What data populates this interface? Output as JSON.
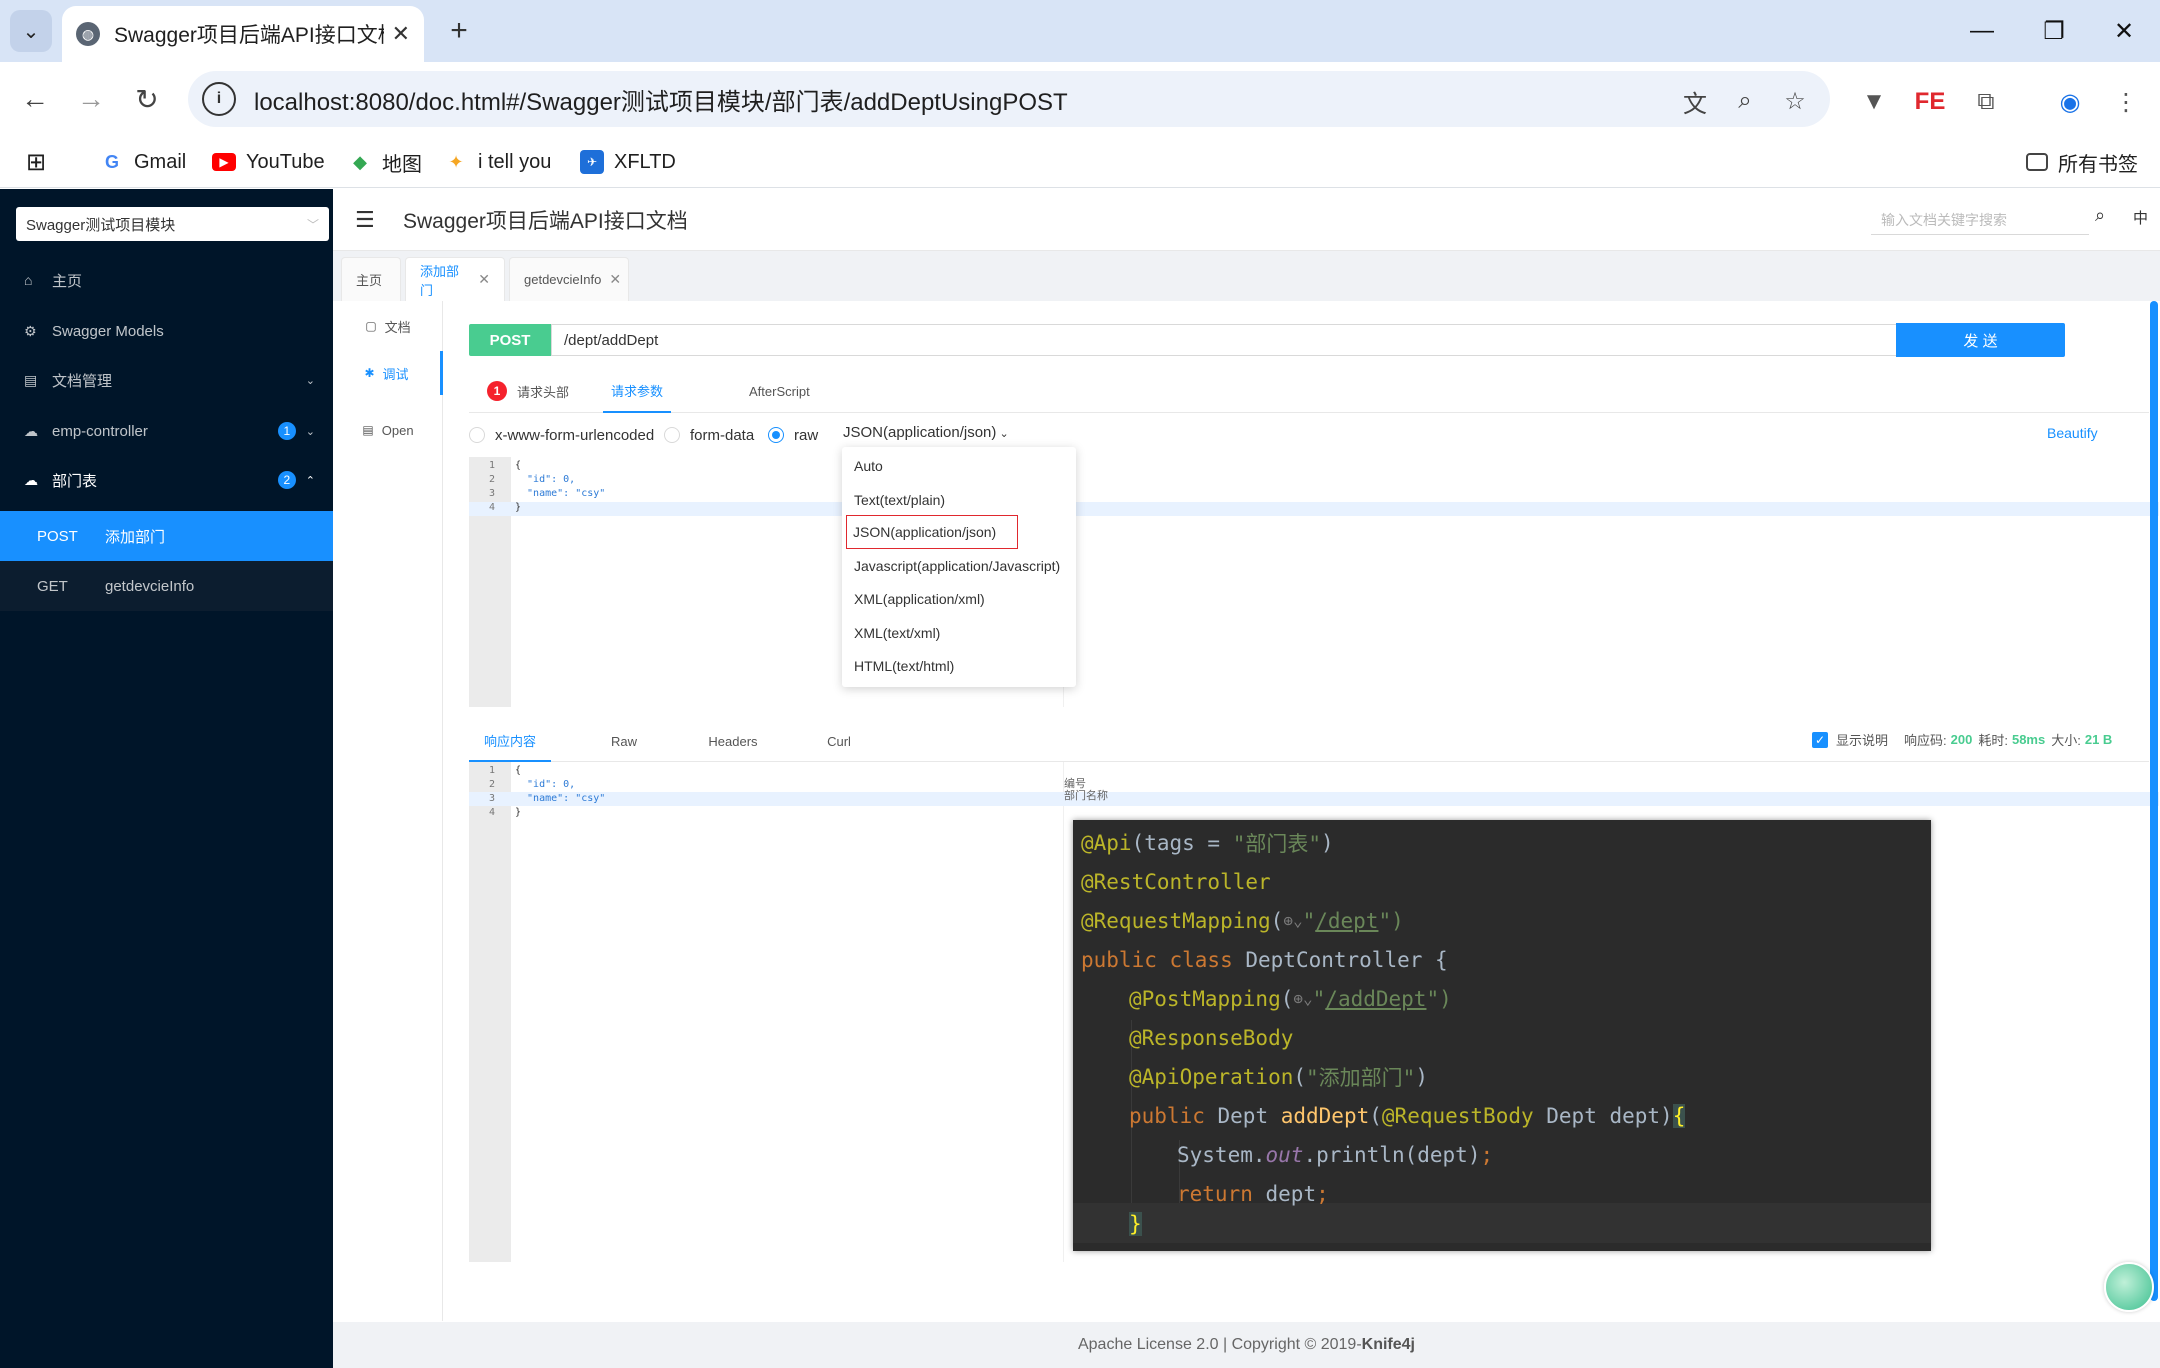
{
  "browser": {
    "tab_title": "Swagger项目后端API接口文档",
    "url_host": "localhost",
    "url_rest": ":8080/doc.html#/Swagger测试项目模块/部门表/addDeptUsingPOST",
    "bookmarks": [
      {
        "label": "Gmail",
        "icon": "gmail-icon",
        "color": "#4285f4"
      },
      {
        "label": "YouTube",
        "icon": "youtube-icon",
        "color": "#ff0000"
      },
      {
        "label": "地图",
        "icon": "maps-icon",
        "color": "#34a853"
      },
      {
        "label": "i tell you",
        "icon": "itellyou-icon",
        "color": "#f5a623"
      },
      {
        "label": "XFLTD",
        "icon": "xfltd-icon",
        "color": "#1e6fd9"
      }
    ],
    "all_bookmarks": "所有书签"
  },
  "sidebar": {
    "group_select": "Swagger测试项目模块",
    "menu": [
      {
        "label": "主页",
        "icon": "home-icon"
      },
      {
        "label": "Swagger Models",
        "icon": "models-icon"
      },
      {
        "label": "文档管理",
        "icon": "doc-manage-icon"
      },
      {
        "label": "emp-controller",
        "icon": "cloud-icon",
        "badge": "1"
      },
      {
        "label": "部门表",
        "icon": "cloud-icon",
        "badge": "2"
      }
    ],
    "apis": [
      {
        "method": "POST",
        "name": "添加部门"
      },
      {
        "method": "GET",
        "name": "getdevcieInfo"
      }
    ]
  },
  "header": {
    "title": "Swagger项目后端API接口文档",
    "search_placeholder": "输入文档关键字搜索",
    "lang": "中"
  },
  "doc_tabs": [
    "主页",
    "添加部门",
    "getdevcieInfo"
  ],
  "vtabs": [
    "文档",
    "调试",
    "Open"
  ],
  "request": {
    "method": "POST",
    "path": "/dept/addDept",
    "send": "发 送",
    "tabs": {
      "headers": "请求头部",
      "headers_badge": "1",
      "params": "请求参数",
      "after": "AfterScript"
    },
    "body_types": [
      "x-www-form-urlencoded",
      "form-data",
      "raw"
    ],
    "content_type": "JSON(application/json)",
    "beautify": "Beautify",
    "body_lines": [
      "{",
      "  \"id\": 0,",
      "  \"name\": \"csy\"",
      "}"
    ],
    "line_numbers": [
      "1",
      "2",
      "3",
      "4"
    ]
  },
  "content_type_options": [
    "Auto",
    "Text(text/plain)",
    "JSON(application/json)",
    "Javascript(application/Javascript)",
    "XML(application/xml)",
    "XML(text/xml)",
    "HTML(text/html)"
  ],
  "response": {
    "tabs": [
      "响应内容",
      "Raw",
      "Headers",
      "Curl"
    ],
    "show_desc": "显示说明",
    "code_label": "响应码:",
    "code": "200",
    "time_label": "耗时:",
    "time": "58ms",
    "size_label": "大小:",
    "size": "21 B",
    "desc_lines": [
      "编号",
      "部门名称"
    ]
  },
  "ide_code": {
    "l1_a": "@Api",
    "l1_b": "(tags = ",
    "l1_c": "\"部门表\"",
    "l1_d": ")",
    "l2": "@RestController",
    "l3_a": "@RequestMapping",
    "l3_b": "\"",
    "l3_c": "/dept",
    "l3_d": "\")",
    "l4_a": "public class ",
    "l4_b": "DeptController {",
    "l5_a": "@PostMapping",
    "l5_c": "/addDept",
    "l6": "@ResponseBody",
    "l7_a": "@ApiOperation",
    "l7_b": "(",
    "l7_c": "\"添加部门\"",
    "l8_a": "public ",
    "l8_b": "Dept ",
    "l8_c": "addDept",
    "l8_d": "(",
    "l8_e": "@RequestBody",
    "l8_f": " Dept dept)",
    "l8_g": "{",
    "l9_a": "System.",
    "l9_b": "out",
    "l9_c": ".println(dept)",
    "l9_d": ";",
    "l10_a": "return ",
    "l10_b": "dept",
    "l10_c": ";",
    "l11": "}"
  },
  "footer": {
    "text": "Apache License 2.0 | Copyright © 2019-",
    "brand": "Knife4j"
  }
}
